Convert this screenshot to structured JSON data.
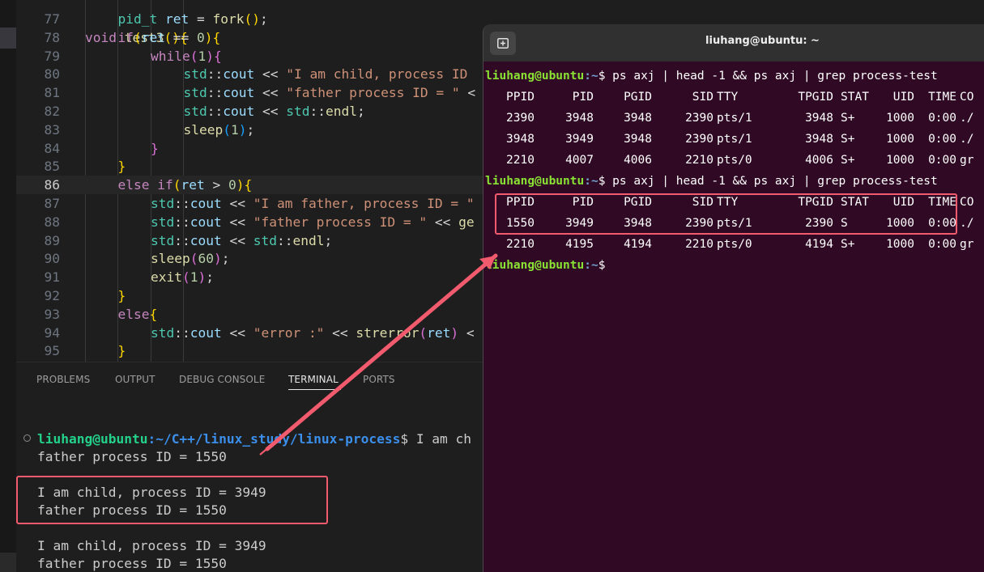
{
  "editor": {
    "lines": [
      {
        "n": "77",
        "tokens": [
          [
            "t-ty",
            "pid_t"
          ],
          [
            "t-op",
            " "
          ],
          [
            "t-var",
            "ret"
          ],
          [
            "t-op",
            " = "
          ],
          [
            "t-fn",
            "fork"
          ],
          [
            "t-p1",
            "()"
          ],
          [
            "t-op",
            ";"
          ]
        ],
        "indent": 1
      },
      {
        "n": "78",
        "tokens": [
          [
            "t-kw",
            "if"
          ],
          [
            "t-p1",
            "("
          ],
          [
            "t-var",
            "ret"
          ],
          [
            "t-op",
            " == "
          ],
          [
            "t-num",
            "0"
          ],
          [
            "t-p1",
            ")"
          ],
          [
            "t-p1",
            "{"
          ]
        ],
        "indent": 1
      },
      {
        "n": "79",
        "tokens": [
          [
            "t-kw",
            "while"
          ],
          [
            "t-p2",
            "("
          ],
          [
            "t-num",
            "1"
          ],
          [
            "t-p2",
            ")"
          ],
          [
            "t-p2",
            "{"
          ]
        ],
        "indent": 2
      },
      {
        "n": "80",
        "tokens": [
          [
            "t-ty",
            "std"
          ],
          [
            "t-op",
            "::"
          ],
          [
            "t-var",
            "cout"
          ],
          [
            "t-op",
            " << "
          ],
          [
            "t-str",
            "\"I am child, process ID"
          ]
        ],
        "indent": 3
      },
      {
        "n": "81",
        "tokens": [
          [
            "t-ty",
            "std"
          ],
          [
            "t-op",
            "::"
          ],
          [
            "t-var",
            "cout"
          ],
          [
            "t-op",
            " << "
          ],
          [
            "t-str",
            "\"father process ID = \""
          ],
          [
            "t-op",
            " <"
          ]
        ],
        "indent": 3
      },
      {
        "n": "82",
        "tokens": [
          [
            "t-ty",
            "std"
          ],
          [
            "t-op",
            "::"
          ],
          [
            "t-var",
            "cout"
          ],
          [
            "t-op",
            " << "
          ],
          [
            "t-ty",
            "std"
          ],
          [
            "t-op",
            "::"
          ],
          [
            "t-fn",
            "endl"
          ],
          [
            "t-op",
            ";"
          ]
        ],
        "indent": 3
      },
      {
        "n": "83",
        "tokens": [
          [
            "t-fn",
            "sleep"
          ],
          [
            "t-p3",
            "("
          ],
          [
            "t-num",
            "1"
          ],
          [
            "t-p3",
            ")"
          ],
          [
            "t-op",
            ";"
          ]
        ],
        "indent": 3
      },
      {
        "n": "84",
        "tokens": [
          [
            "t-p2",
            "}"
          ]
        ],
        "indent": 2
      },
      {
        "n": "85",
        "tokens": [
          [
            "t-p1",
            "}"
          ]
        ],
        "indent": 1
      },
      {
        "n": "86",
        "tokens": [
          [
            "t-kw",
            "else"
          ],
          [
            "t-op",
            " "
          ],
          [
            "t-kw",
            "if"
          ],
          [
            "t-p1",
            "("
          ],
          [
            "t-var",
            "ret"
          ],
          [
            "t-op",
            " > "
          ],
          [
            "t-num",
            "0"
          ],
          [
            "t-p1",
            ")"
          ],
          [
            "t-p1",
            "{"
          ]
        ],
        "indent": 1,
        "current": true
      },
      {
        "n": "87",
        "tokens": [
          [
            "t-ty",
            "std"
          ],
          [
            "t-op",
            "::"
          ],
          [
            "t-var",
            "cout"
          ],
          [
            "t-op",
            " << "
          ],
          [
            "t-str",
            "\"I am father, process ID = \""
          ]
        ],
        "indent": 2
      },
      {
        "n": "88",
        "tokens": [
          [
            "t-ty",
            "std"
          ],
          [
            "t-op",
            "::"
          ],
          [
            "t-var",
            "cout"
          ],
          [
            "t-op",
            " << "
          ],
          [
            "t-str",
            "\"father process ID = \""
          ],
          [
            "t-op",
            " << "
          ],
          [
            "t-fn",
            "ge"
          ]
        ],
        "indent": 2
      },
      {
        "n": "89",
        "tokens": [
          [
            "t-ty",
            "std"
          ],
          [
            "t-op",
            "::"
          ],
          [
            "t-var",
            "cout"
          ],
          [
            "t-op",
            " << "
          ],
          [
            "t-ty",
            "std"
          ],
          [
            "t-op",
            "::"
          ],
          [
            "t-fn",
            "endl"
          ],
          [
            "t-op",
            ";"
          ]
        ],
        "indent": 2
      },
      {
        "n": "90",
        "tokens": [
          [
            "t-fn",
            "sleep"
          ],
          [
            "t-p2",
            "("
          ],
          [
            "t-num",
            "60"
          ],
          [
            "t-p2",
            ")"
          ],
          [
            "t-op",
            ";"
          ]
        ],
        "indent": 2
      },
      {
        "n": "91",
        "tokens": [
          [
            "t-fn",
            "exit"
          ],
          [
            "t-p2",
            "("
          ],
          [
            "t-num",
            "1"
          ],
          [
            "t-p2",
            ")"
          ],
          [
            "t-op",
            ";"
          ]
        ],
        "indent": 2
      },
      {
        "n": "92",
        "tokens": [
          [
            "t-p1",
            "}"
          ]
        ],
        "indent": 1
      },
      {
        "n": "93",
        "tokens": [
          [
            "t-kw",
            "else"
          ],
          [
            "t-p1",
            "{"
          ]
        ],
        "indent": 1
      },
      {
        "n": "94",
        "tokens": [
          [
            "t-ty",
            "std"
          ],
          [
            "t-op",
            "::"
          ],
          [
            "t-var",
            "cout"
          ],
          [
            "t-op",
            " << "
          ],
          [
            "t-str",
            "\"error :\""
          ],
          [
            "t-op",
            " << "
          ],
          [
            "t-fn",
            "strerror"
          ],
          [
            "t-p2",
            "("
          ],
          [
            "t-var",
            "ret"
          ],
          [
            "t-p2",
            ")"
          ],
          [
            "t-op",
            " <"
          ]
        ],
        "indent": 2
      },
      {
        "n": "95",
        "tokens": [
          [
            "t-p1",
            "}"
          ]
        ],
        "indent": 1
      }
    ]
  },
  "panel": {
    "tabs": [
      "PROBLEMS",
      "OUTPUT",
      "DEBUG CONSOLE",
      "TERMINAL",
      "PORTS"
    ],
    "active_tab": "TERMINAL"
  },
  "vscode_terminal": {
    "prompt_user": "liuhang@ubuntu",
    "prompt_path": ":~/C++/linux_study/linux-process",
    "prompt_tail": "$ I am ch",
    "lines": [
      "father process ID = 1550",
      "I am child, process ID = 3949",
      "father process ID = 1550",
      "I am child, process ID = 3949",
      "father process ID = 1550"
    ]
  },
  "ubuntu_terminal": {
    "title": "liuhang@ubuntu: ~",
    "prompt_user": "liuhang@ubuntu",
    "prompt_path": ":~",
    "command": "$ ps axj | head -1 && ps axj | grep process-test",
    "final_prompt": "$",
    "header": [
      "PPID",
      "PID",
      "PGID",
      "SID",
      "TTY",
      "TPGID",
      "STAT",
      "UID",
      "TIME",
      "CO"
    ],
    "block1": [
      [
        "2390",
        "3948",
        "3948",
        "2390",
        "pts/1",
        "3948",
        "S+",
        "1000",
        "0:00",
        "./"
      ],
      [
        "3948",
        "3949",
        "3948",
        "2390",
        "pts/1",
        "3948",
        "S+",
        "1000",
        "0:00",
        "./"
      ],
      [
        "2210",
        "4007",
        "4006",
        "2210",
        "pts/0",
        "4006",
        "S+",
        "1000",
        "0:00",
        "gr"
      ]
    ],
    "block2": [
      [
        "1550",
        "3949",
        "3948",
        "2390",
        "pts/1",
        "2390",
        "S",
        "1000",
        "0:00",
        "./"
      ],
      [
        "2210",
        "4195",
        "4194",
        "2210",
        "pts/0",
        "4194",
        "S+",
        "1000",
        "0:00",
        "gr"
      ]
    ]
  },
  "colors": {
    "highlight": "#f25a6e",
    "terminal_bg": "#300a24",
    "editor_bg": "#1e1e1e"
  }
}
